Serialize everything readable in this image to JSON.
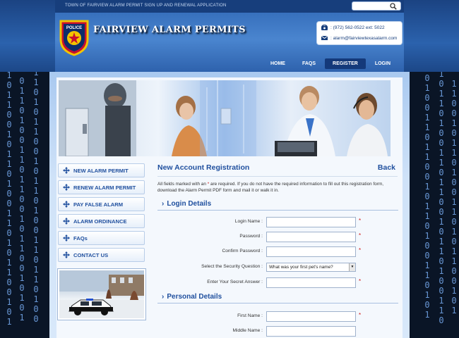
{
  "header": {
    "top_text": "TOWN OF FAIRVIEW ALARM PERMIT SIGN UP AND RENEWAL APPLICATION",
    "site_title": "FAIRVIEW ALARM PERMITS",
    "badge_text": "POLICE",
    "phone": ": (972) 562-0522 ext: 5022",
    "email": ": alarm@fairviewtexasalarm.com"
  },
  "nav": {
    "items": [
      {
        "label": "HOME"
      },
      {
        "label": "FAQS"
      },
      {
        "label": "REGISTER"
      },
      {
        "label": "LOGIN"
      }
    ],
    "active": "REGISTER"
  },
  "sidebar": {
    "items": [
      {
        "label": "NEW ALARM PERMIT"
      },
      {
        "label": "RENEW ALARM PERMIT"
      },
      {
        "label": "PAY FALSE ALARM"
      },
      {
        "label": "ALARM ORDINANCE"
      },
      {
        "label": "FAQs"
      },
      {
        "label": "CONTACT US"
      }
    ]
  },
  "form": {
    "title": "New Account Registration",
    "back_label": "Back",
    "intro_prefix": "All fields marked with an ",
    "intro_star": "*",
    "intro_suffix": " are required. If you do not have the required information to fill out this registration form, download the Alarm Permit PDF form and mail it or walk it in.",
    "login_section": "Login Details",
    "personal_section": "Personal Details",
    "fields": {
      "login_name": "Login Name :",
      "password": "Password :",
      "confirm_password": "Confirm Password :",
      "security_question": "Select the Security Question :",
      "security_question_value": "What was your first pet's name?",
      "secret_answer": "Enter Your Secret Answer :",
      "first_name": "First Name :",
      "middle_name": "Middle Name :"
    },
    "required_mark": "*"
  },
  "colors": {
    "brand_blue": "#1f4f9e",
    "required_red": "#d01818",
    "nav_active": "#14397a"
  }
}
